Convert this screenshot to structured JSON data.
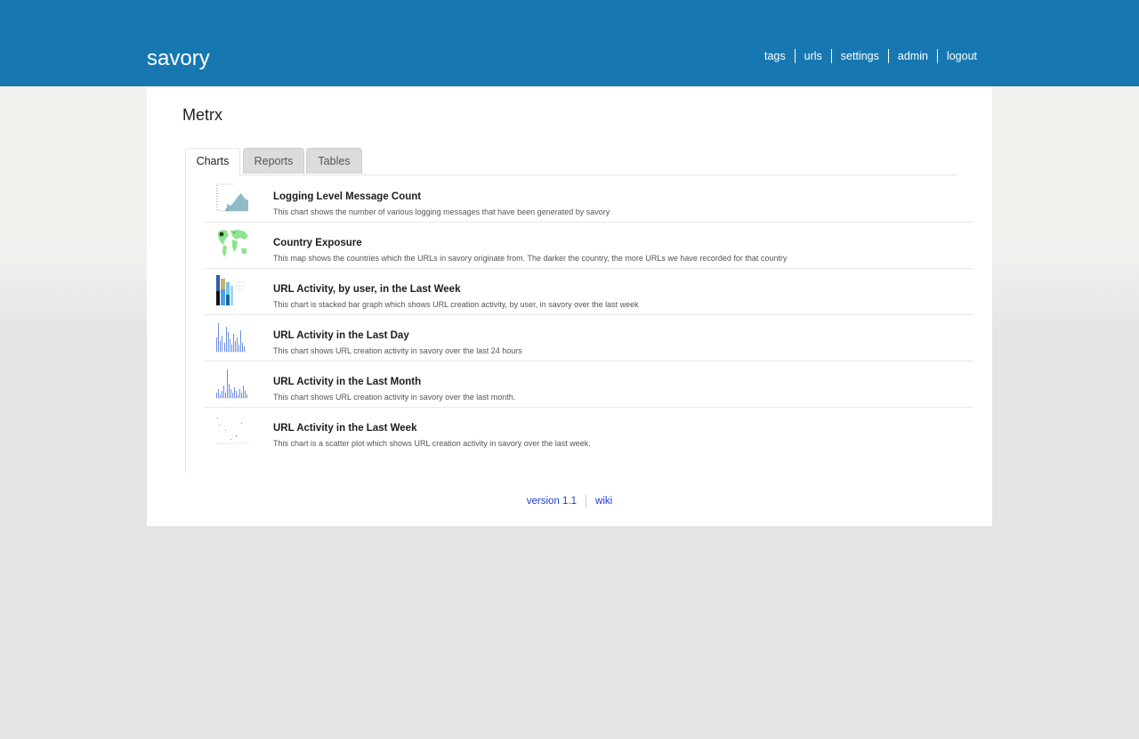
{
  "header": {
    "brand": "savory",
    "nav": [
      "tags",
      "urls",
      "settings",
      "admin",
      "logout"
    ]
  },
  "page": {
    "title": "Metrx"
  },
  "tabs": [
    {
      "label": "Charts",
      "active": true
    },
    {
      "label": "Reports",
      "active": false
    },
    {
      "label": "Tables",
      "active": false
    }
  ],
  "charts": [
    {
      "title": "Logging Level Message Count",
      "description": "This chart shows the number of various logging messages that have been generated by savory",
      "thumbnail": "area-chart-thumbnail"
    },
    {
      "title": "Country Exposure",
      "description": "This map shows the countries which the URLs in savory originate from. The darker the country, the more URLs we have recorded for that country",
      "thumbnail": "world-map-thumbnail"
    },
    {
      "title": "URL Activity, by user, in the Last Week",
      "description": "This chart is stacked bar graph which shows URL creation activity, by user, in savory over the last week",
      "thumbnail": "stacked-bar-thumbnail"
    },
    {
      "title": "URL Activity in the Last Day",
      "description": "This chart shows URL creation activity in savory over the last 24 hours",
      "thumbnail": "bar-chart-thumbnail"
    },
    {
      "title": "URL Activity in the Last Month",
      "description": "This chart shows URL creation activity in savory over the last month.",
      "thumbnail": "bar-chart-thumbnail"
    },
    {
      "title": "URL Activity in the Last Week",
      "description": "This chart is a scatter plot which shows URL creation activity in savory over the last week.",
      "thumbnail": "scatter-plot-thumbnail"
    }
  ],
  "footer": {
    "version": "version 1.1",
    "wiki": "wiki"
  },
  "colors": {
    "header_bg": "#1778b1",
    "link": "#1a3fd1"
  }
}
